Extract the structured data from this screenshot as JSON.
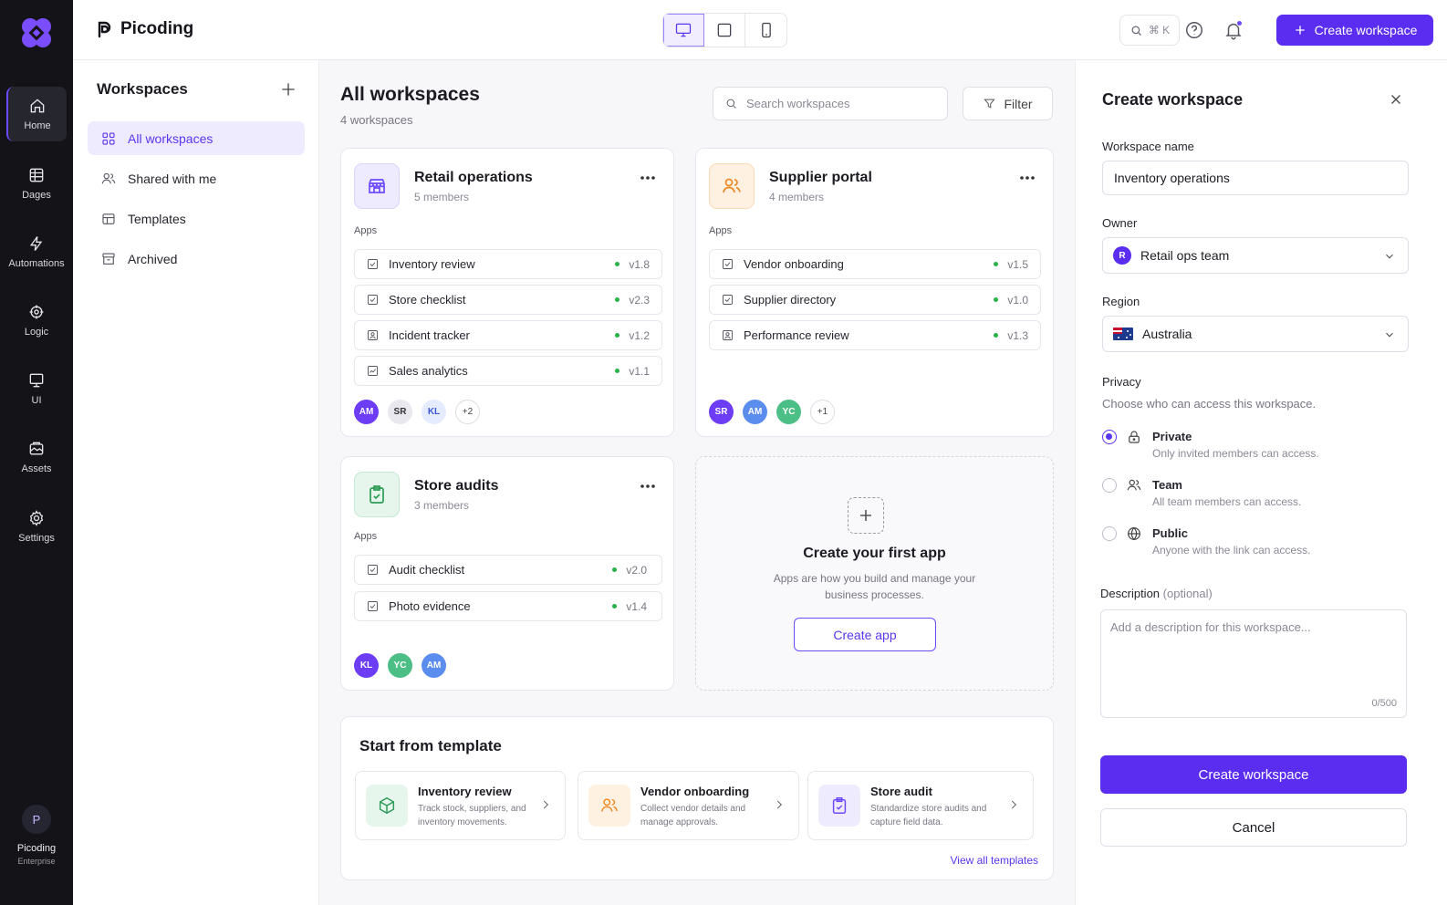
{
  "rail": {
    "items": [
      {
        "label": "Home",
        "icon": "home-icon"
      },
      {
        "label": "Dages",
        "icon": "table-icon"
      },
      {
        "label": "Automations",
        "icon": "lightning-icon"
      },
      {
        "label": "Logic",
        "icon": "logic-icon"
      },
      {
        "label": "UI",
        "icon": "monitor-icon"
      },
      {
        "label": "Assets",
        "icon": "assets-icon"
      },
      {
        "label": "Settings",
        "icon": "gear-icon"
      }
    ],
    "user": {
      "initial": "P",
      "name": "Picoding",
      "plan": "Enterprise"
    }
  },
  "topbar": {
    "brand": "Picoding",
    "search_shortcut": "⌘ K",
    "create_label": "Create workspace",
    "accent": "#5a2df0"
  },
  "sidebar": {
    "title": "Workspaces",
    "items": [
      {
        "label": "All workspaces",
        "icon": "grid-icon",
        "active": true
      },
      {
        "label": "Shared with me",
        "icon": "users-icon"
      },
      {
        "label": "Templates",
        "icon": "template-icon"
      },
      {
        "label": "Archived",
        "icon": "archive-icon"
      }
    ]
  },
  "main": {
    "title": "All workspaces",
    "subtitle": "4 workspaces",
    "search_placeholder": "Search workspaces",
    "filter_label": "Filter",
    "apps_label": "Apps",
    "workspaces": [
      {
        "name": "Retail operations",
        "members": "5 members",
        "apps": [
          {
            "name": "Inventory review",
            "version": "v1.8"
          },
          {
            "name": "Store checklist",
            "version": "v2.3"
          },
          {
            "name": "Incident tracker",
            "version": "v1.2"
          },
          {
            "name": "Sales analytics",
            "version": "v1.1"
          }
        ],
        "avatars": [
          "AM",
          "SR",
          "KL"
        ],
        "more": "+2"
      },
      {
        "name": "Supplier portal",
        "members": "4 members",
        "apps": [
          {
            "name": "Vendor onboarding",
            "version": "v1.5"
          },
          {
            "name": "Supplier directory",
            "version": "v1.0"
          },
          {
            "name": "Performance review",
            "version": "v1.3"
          }
        ],
        "avatars": [
          "SR",
          "AM",
          "YC"
        ],
        "more": "+1"
      },
      {
        "name": "Store audits",
        "members": "3 members",
        "apps": [
          {
            "name": "Audit checklist",
            "version": "v2.0"
          },
          {
            "name": "Photo evidence",
            "version": "v1.4"
          }
        ],
        "avatars": [
          "KL",
          "YC",
          "AM"
        ]
      }
    ],
    "empty": {
      "title": "Create your first app",
      "desc": "Apps are how you build and manage your business processes.",
      "button": "Create app"
    },
    "templates": {
      "title": "Start from template",
      "items": [
        {
          "name": "Inventory review",
          "desc": "Track stock, suppliers, and inventory movements."
        },
        {
          "name": "Vendor onboarding",
          "desc": "Collect vendor details and manage approvals."
        },
        {
          "name": "Store audit",
          "desc": "Standardize store audits and capture field data."
        }
      ],
      "view_all": "View all templates"
    }
  },
  "panel": {
    "title": "Create workspace",
    "name_label": "Workspace name",
    "name_value": "Inventory operations",
    "owner_label": "Owner",
    "owner_initial": "R",
    "owner_value": "Retail ops team",
    "region_label": "Region",
    "region_value": "Australia",
    "privacy_label": "Privacy",
    "privacy_help": "Choose who can access this workspace.",
    "privacy_options": [
      {
        "title": "Private",
        "desc": "Only invited members can access.",
        "checked": true
      },
      {
        "title": "Team",
        "desc": "All team members can access."
      },
      {
        "title": "Public",
        "desc": "Anyone with the link can access."
      }
    ],
    "description_label": "Description",
    "description_optional": "(optional)",
    "description_placeholder": "Add a description for this workspace...",
    "counter": "0/500",
    "submit_label": "Create workspace",
    "cancel_label": "Cancel"
  }
}
